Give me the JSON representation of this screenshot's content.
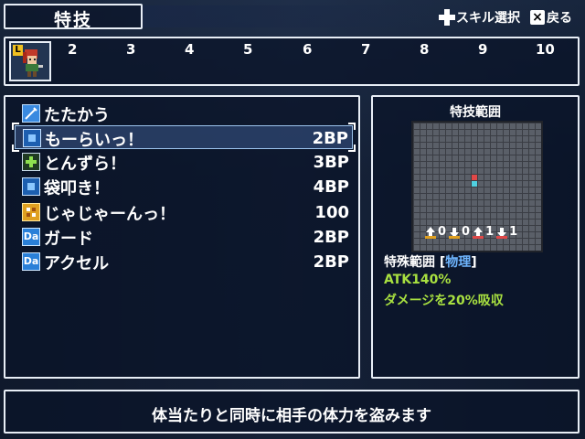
{
  "header": {
    "title": "特技",
    "hint_skill_select": "スキル選択",
    "hint_back": "戻る",
    "back_key_icon": "x-button-icon",
    "select_key_icon": "dpad-icon"
  },
  "party": {
    "leader_badge": "L",
    "slots": [
      "2",
      "3",
      "4",
      "5",
      "6",
      "7",
      "8",
      "9",
      "10"
    ]
  },
  "skills": [
    {
      "name": "たたかう",
      "cost": "",
      "icon": "sword-icon"
    },
    {
      "name": "もーらいっ！",
      "cost": "2BP",
      "icon": "blue-skill-icon",
      "selected": true
    },
    {
      "name": "とんずら！",
      "cost": "3BP",
      "icon": "green-cross-icon"
    },
    {
      "name": "袋叩き！",
      "cost": "4BP",
      "icon": "blue-skill-icon"
    },
    {
      "name": "じゃじゃーんっ！",
      "cost": "100",
      "icon": "orange-skill-icon"
    },
    {
      "name": "ガード",
      "cost": "2BP",
      "icon": "da-icon"
    },
    {
      "name": "アクセル",
      "cost": "2BP",
      "icon": "da-icon"
    }
  ],
  "icon_label_da": "Da",
  "range": {
    "title": "特技範囲",
    "enemy_counts": [
      "0",
      "0",
      "1",
      "1"
    ],
    "range_type_label": "特殊範囲",
    "attribute": "物理",
    "attack": "ATK140%",
    "effect": "ダメージを20%吸収"
  },
  "description": "体当たりと同時に相手の体力を盗みます",
  "colors": {
    "attribute": "#6fb6ff",
    "effect": "#a8e040",
    "target_cell": "#e04848",
    "self_cell": "#50d0e0"
  }
}
